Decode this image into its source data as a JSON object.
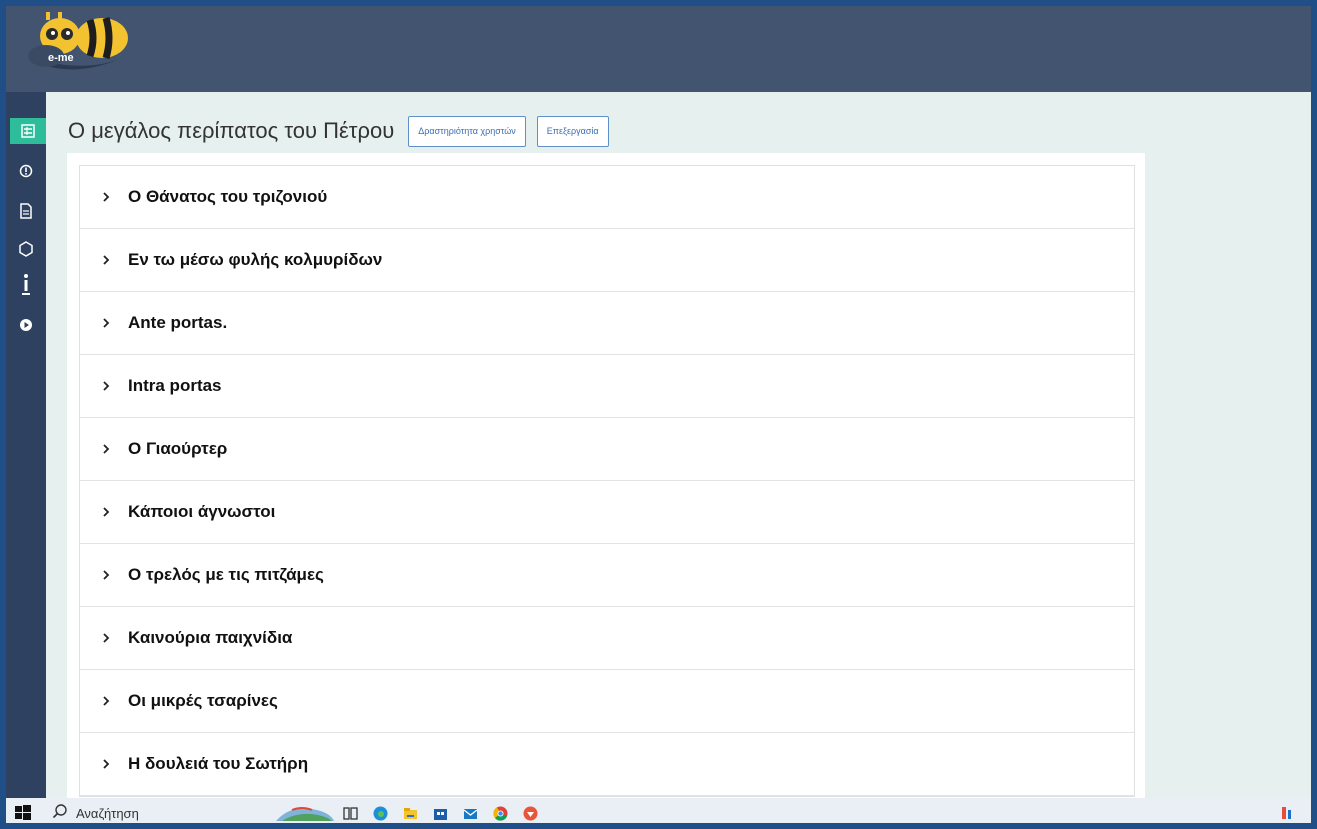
{
  "app": {
    "logo_text": "e-me",
    "title": "Ο μεγάλος περίπατος του Πέτρου",
    "buttons": {
      "activity": "Δραστηριότητα χρηστών",
      "edit": "Επεξεργασία"
    }
  },
  "sidebar": {
    "icons": [
      "list-icon",
      "info-circle-icon",
      "document-icon",
      "hexagon-icon",
      "info-i-icon",
      "play-circle-icon"
    ]
  },
  "chapters": [
    "Ο Θάνατος του τριζονιού",
    "Εν τω μέσω φυλής κολμυρίδων",
    "Ante portas.",
    "Intra portas",
    "Ο Γιαούρτερ",
    "Κάποιοι άγνωστοι",
    "Ο τρελός με τις πιτζάμες",
    "Καινούρια παιχνίδια",
    "Οι μικρές τσαρίνες",
    "Η δουλειά του Σωτήρη"
  ],
  "taskbar": {
    "search_placeholder": "Αναζήτηση",
    "icons": [
      "windows-start-icon",
      "search-icon",
      "weather-widget-icon",
      "task-view-icon",
      "edge-icon",
      "file-explorer-icon",
      "store-icon",
      "mail-icon",
      "chrome-icon",
      "brave-icon",
      "temperature-icon"
    ]
  },
  "colors": {
    "topbar": "#425470",
    "sidebar": "#2f4160",
    "accent": "#2dbd9b",
    "main_bg": "#e6f0ee",
    "button_border": "#5f90c9"
  }
}
